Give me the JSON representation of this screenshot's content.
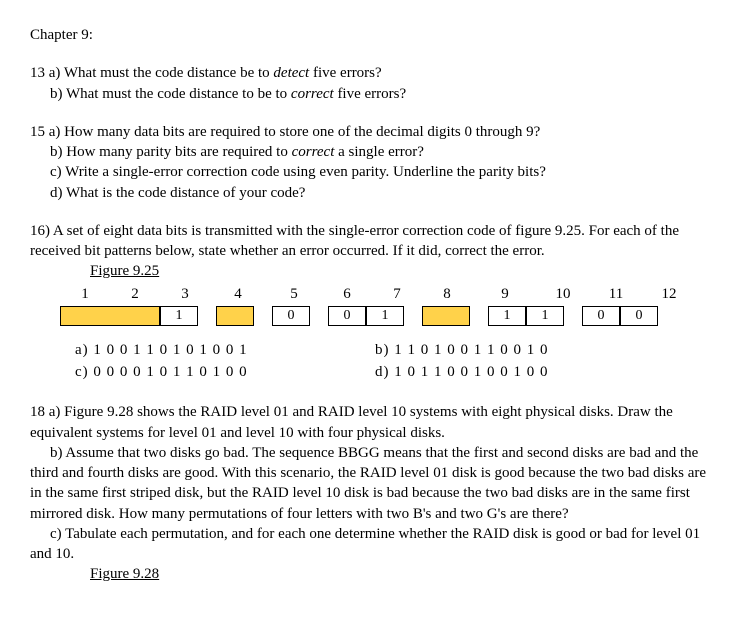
{
  "chapter": "Chapter 9:",
  "q13": {
    "a_pre": "13 a) What must the code distance be to ",
    "a_em": "detect",
    "a_post": " five errors?",
    "b_pre": "b) What must the code distance to be to ",
    "b_em": "correct",
    "b_post": " five errors?"
  },
  "q15": {
    "a": "15 a) How many data bits are required to store one of the decimal digits 0 through 9?",
    "b_pre": "b) How many parity bits are required to ",
    "b_em": "correct",
    "b_post": " a single error?",
    "c": "c) Write a single-error correction code using even parity. Underline the parity bits?",
    "d": "d) What is the code distance of your code?"
  },
  "q16": {
    "intro": "16) A set of eight data bits is transmitted with the single-error correction code of figure 9.25. For each of the received bit patterns below, state whether an error occurred. If it did, correct the error.",
    "fig_label": "Figure 9.25",
    "headers": [
      "1",
      "2",
      "3",
      "4",
      "5",
      "6",
      "7",
      "8",
      "9",
      "10",
      "11",
      "12"
    ],
    "cells": [
      {
        "v": "",
        "shade": true
      },
      {
        "v": "",
        "shade": true
      },
      {
        "v": "1",
        "shade": false
      },
      {
        "v": "",
        "shade": true
      },
      {
        "v": "0",
        "shade": false
      },
      {
        "v": "0",
        "shade": false
      },
      {
        "v": "1",
        "shade": false
      },
      {
        "v": "",
        "shade": true
      },
      {
        "v": "1",
        "shade": false
      },
      {
        "v": "1",
        "shade": false
      },
      {
        "v": "0",
        "shade": false
      },
      {
        "v": "0",
        "shade": false
      }
    ],
    "opts": {
      "a": "a) 1 0 0 1 1 0 1 0 1 0 0 1",
      "b": "b) 1 1 0 1 0 0 1 1 0 0 1 0",
      "c": "c) 0 0 0 0 1 0 1 1 0 1 0 0",
      "d": "d) 1 0 1 1 0 0 1 0 0 1 0 0"
    }
  },
  "q18": {
    "a": "18 a) Figure 9.28 shows the RAID level 01 and RAID level 10 systems with eight physical disks. Draw the equivalent systems for level 01 and level 10 with four physical disks.",
    "b": "b) Assume that two disks go bad. The sequence BBGG means that the first and second disks are bad and the third and fourth disks are good. With this scenario, the RAID level 01 disk is good because the two bad disks are in the same first striped disk, but the RAID level 10 disk is bad because the two bad disks are in the same first mirrored disk. How many permutations of four letters with two B's and two G's are there?",
    "c": "c) Tabulate each permutation, and for each one determine whether the RAID disk is good or bad for level 01 and 10.",
    "fig_label": "Figure 9.28"
  }
}
